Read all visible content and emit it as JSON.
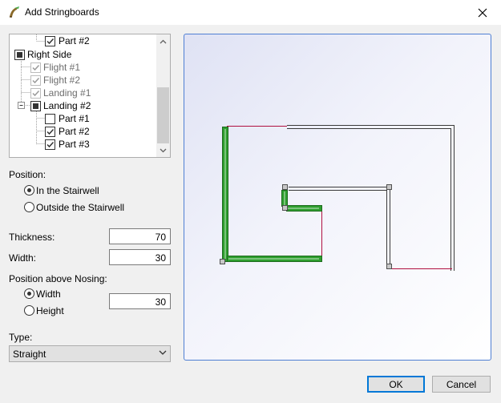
{
  "window": {
    "title": "Add Stringboards"
  },
  "tree": {
    "rows": [
      {
        "label": "Part #2",
        "state": "checked",
        "disabled": false
      },
      {
        "label": "Right Side",
        "state": "partial",
        "disabled": false
      },
      {
        "label": "Flight #1",
        "state": "checked",
        "disabled": true
      },
      {
        "label": "Flight #2",
        "state": "checked",
        "disabled": true
      },
      {
        "label": "Landing #1",
        "state": "checked",
        "disabled": true
      },
      {
        "label": "Landing #2",
        "state": "partial",
        "disabled": false
      },
      {
        "label": "Part #1",
        "state": "unchecked",
        "disabled": false
      },
      {
        "label": "Part #2",
        "state": "checked",
        "disabled": false
      },
      {
        "label": "Part #3",
        "state": "checked",
        "disabled": false
      }
    ]
  },
  "position": {
    "label": "Position:",
    "options": [
      {
        "label": "In the Stairwell",
        "checked": true
      },
      {
        "label": "Outside the Stairwell",
        "checked": false
      }
    ]
  },
  "thickness": {
    "label": "Thickness:",
    "value": "70"
  },
  "width": {
    "label": "Width:",
    "value": "30"
  },
  "nosing": {
    "label": "Position above Nosing:",
    "options": [
      {
        "label": "Width",
        "checked": true
      },
      {
        "label": "Height",
        "checked": false
      }
    ],
    "value": "30"
  },
  "type": {
    "label": "Type:",
    "value": "Straight"
  },
  "buttons": {
    "ok": "OK",
    "cancel": "Cancel"
  },
  "colors": {
    "accent": "#0078d7",
    "stringboard": "#2e9e2e",
    "preview_border": "#4f7fd3",
    "wall_edge": "#b01040"
  }
}
